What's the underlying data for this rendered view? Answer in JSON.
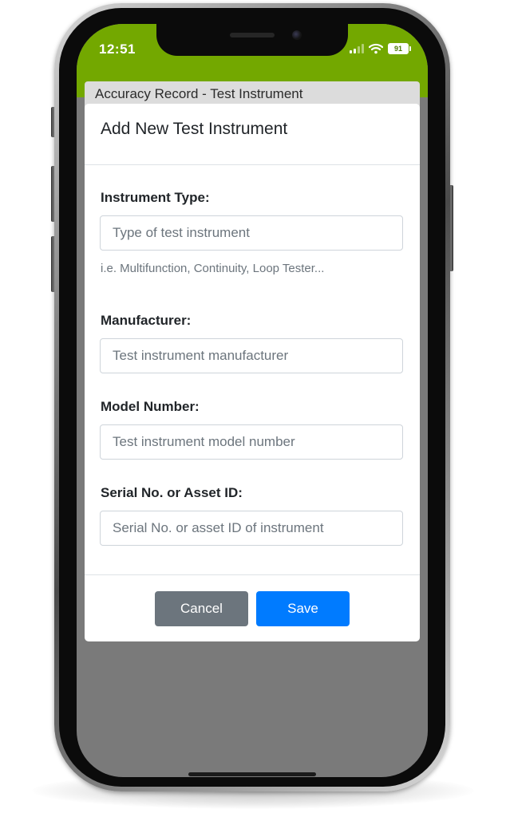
{
  "status_bar": {
    "time": "12:51",
    "battery_level": "91",
    "background_color": "#73a800",
    "icons": [
      "signal-icon",
      "wifi-icon",
      "battery-icon"
    ]
  },
  "page": {
    "title": "Accuracy Record - Test Instrument"
  },
  "modal": {
    "title": "Add New Test Instrument",
    "fields": [
      {
        "label": "Instrument Type:",
        "value": "",
        "placeholder": "Type of test instrument",
        "help": "i.e. Multifunction, Continuity, Loop Tester..."
      },
      {
        "label": "Manufacturer:",
        "value": "",
        "placeholder": "Test instrument manufacturer"
      },
      {
        "label": "Model Number:",
        "value": "",
        "placeholder": "Test instrument model number"
      },
      {
        "label": "Serial No. or Asset ID:",
        "value": "",
        "placeholder": "Serial No. or asset ID of instrument"
      }
    ],
    "buttons": {
      "cancel_label": "Cancel",
      "save_label": "Save"
    }
  },
  "colors": {
    "primary": "#007bff",
    "secondary": "#6c757d",
    "backdrop": "#7a7a7a",
    "header_green": "#73a800"
  }
}
